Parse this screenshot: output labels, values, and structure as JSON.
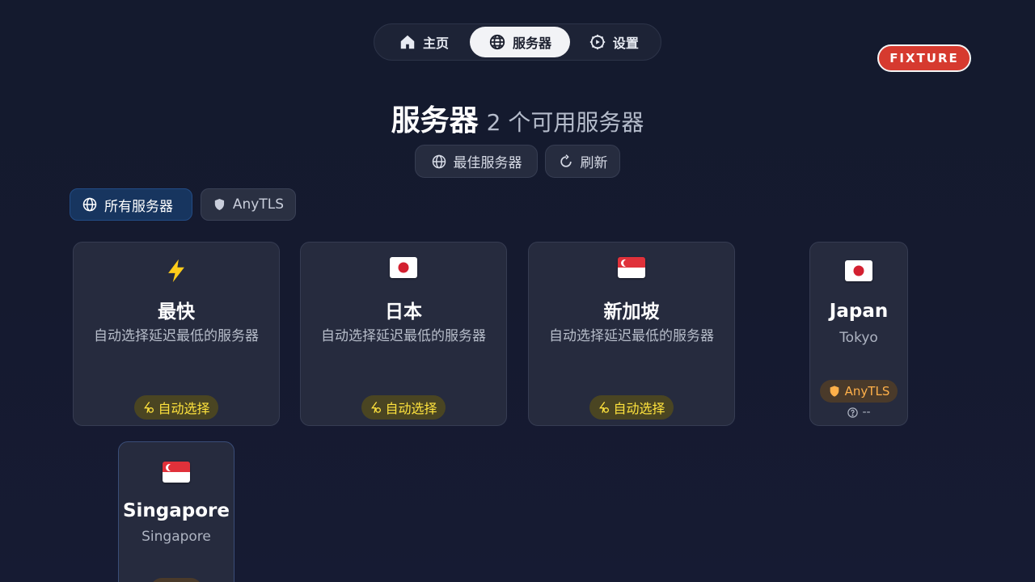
{
  "nav": {
    "home_label": "主页",
    "servers_label": "服务器",
    "settings_label": "设置"
  },
  "badge": "FIXTURE",
  "header": {
    "title": "服务器",
    "subtitle": "2 个可用服务器"
  },
  "actions": {
    "best_label": "最佳服务器",
    "refresh_label": "刷新"
  },
  "filters": {
    "all_label": "所有服务器",
    "anytls_label": "AnyTLS"
  },
  "auto_cards": [
    {
      "icon": "lightning-icon",
      "title": "最快",
      "description": "自动选择延迟最低的服务器",
      "pill": "自动选择"
    },
    {
      "icon": "japan-flag",
      "title": "日本",
      "description": "自动选择延迟最低的服务器",
      "pill": "自动选择"
    },
    {
      "icon": "singapore-flag",
      "title": "新加坡",
      "description": "自动选择延迟最低的服务器",
      "pill": "自动选择"
    }
  ],
  "servers": [
    {
      "icon": "japan-flag",
      "name": "Japan",
      "city": "Tokyo",
      "protocol": "AnyTLS",
      "latency": "--"
    },
    {
      "icon": "singapore-flag",
      "name": "Singapore",
      "city": "Singapore"
    }
  ],
  "colors": {
    "background": "#151a2f",
    "accent_auto": "#ffe33d",
    "accent_protocol": "#ffb04a",
    "badge_red": "#d63a2f",
    "filter_active": "#17355f"
  }
}
